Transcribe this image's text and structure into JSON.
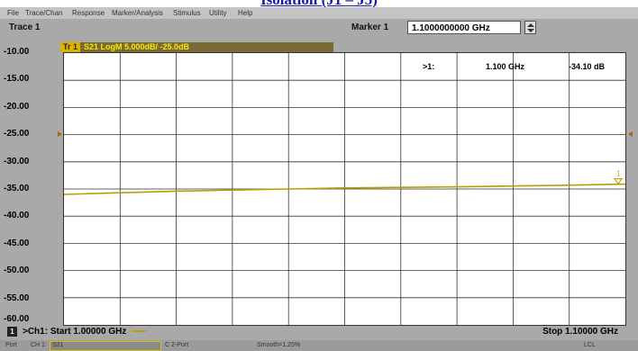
{
  "caption": "Isolation (J1 – J5)",
  "menu": [
    "File",
    "Trace/Chan",
    "Response",
    "Marker/Analysis",
    "Stimulus",
    "Utility",
    "Help"
  ],
  "toolbar": {
    "trace": "Trace 1",
    "marker_label": "Marker 1",
    "marker_value": "1.1000000000 GHz"
  },
  "trace": {
    "badge": "Tr 1",
    "title": "S21 LogM 5.000dB/ -25.0dB"
  },
  "marker_readout": {
    "id": ">1:",
    "freq": "1.100 GHz",
    "value": "-34.10 dB"
  },
  "channel": {
    "number": "1",
    "start": ">Ch1: Start 1.00000 GHz",
    "stop": "Stop 1.10000 GHz"
  },
  "footer": {
    "port": "Port",
    "ch": "CH 1:",
    "ch_field": "S21",
    "cal": "C 2-Port",
    "smooth": "Smooth=1.25%",
    "lcl": "LCL"
  },
  "colors": {
    "trace": "#b8a000",
    "marker": "#c8a000",
    "reference": "#b46400"
  },
  "chart_data": {
    "type": "line",
    "title": "S21 LogM 5.000dB/ -25.0dB",
    "yticks": [
      "-10.00",
      "-15.00",
      "-20.00",
      "-25.00",
      "-30.00",
      "-35.00",
      "-40.00",
      "-45.00",
      "-50.00",
      "-55.00",
      "-60.00"
    ],
    "ylim": [
      -60,
      -10
    ],
    "xlim": [
      1.0,
      1.1
    ],
    "x_unit": "GHz",
    "grid": true,
    "reference_level_db": -25,
    "series": [
      {
        "x": [
          1.0,
          1.01,
          1.02,
          1.03,
          1.04,
          1.05,
          1.06,
          1.07,
          1.08,
          1.09,
          1.1
        ],
        "values": [
          -36.0,
          -35.7,
          -35.4,
          -35.2,
          -35.0,
          -34.8,
          -34.7,
          -34.6,
          -34.45,
          -34.3,
          -34.1
        ]
      }
    ],
    "marker": {
      "label": "1",
      "x": 1.1,
      "y": -34.1
    }
  }
}
